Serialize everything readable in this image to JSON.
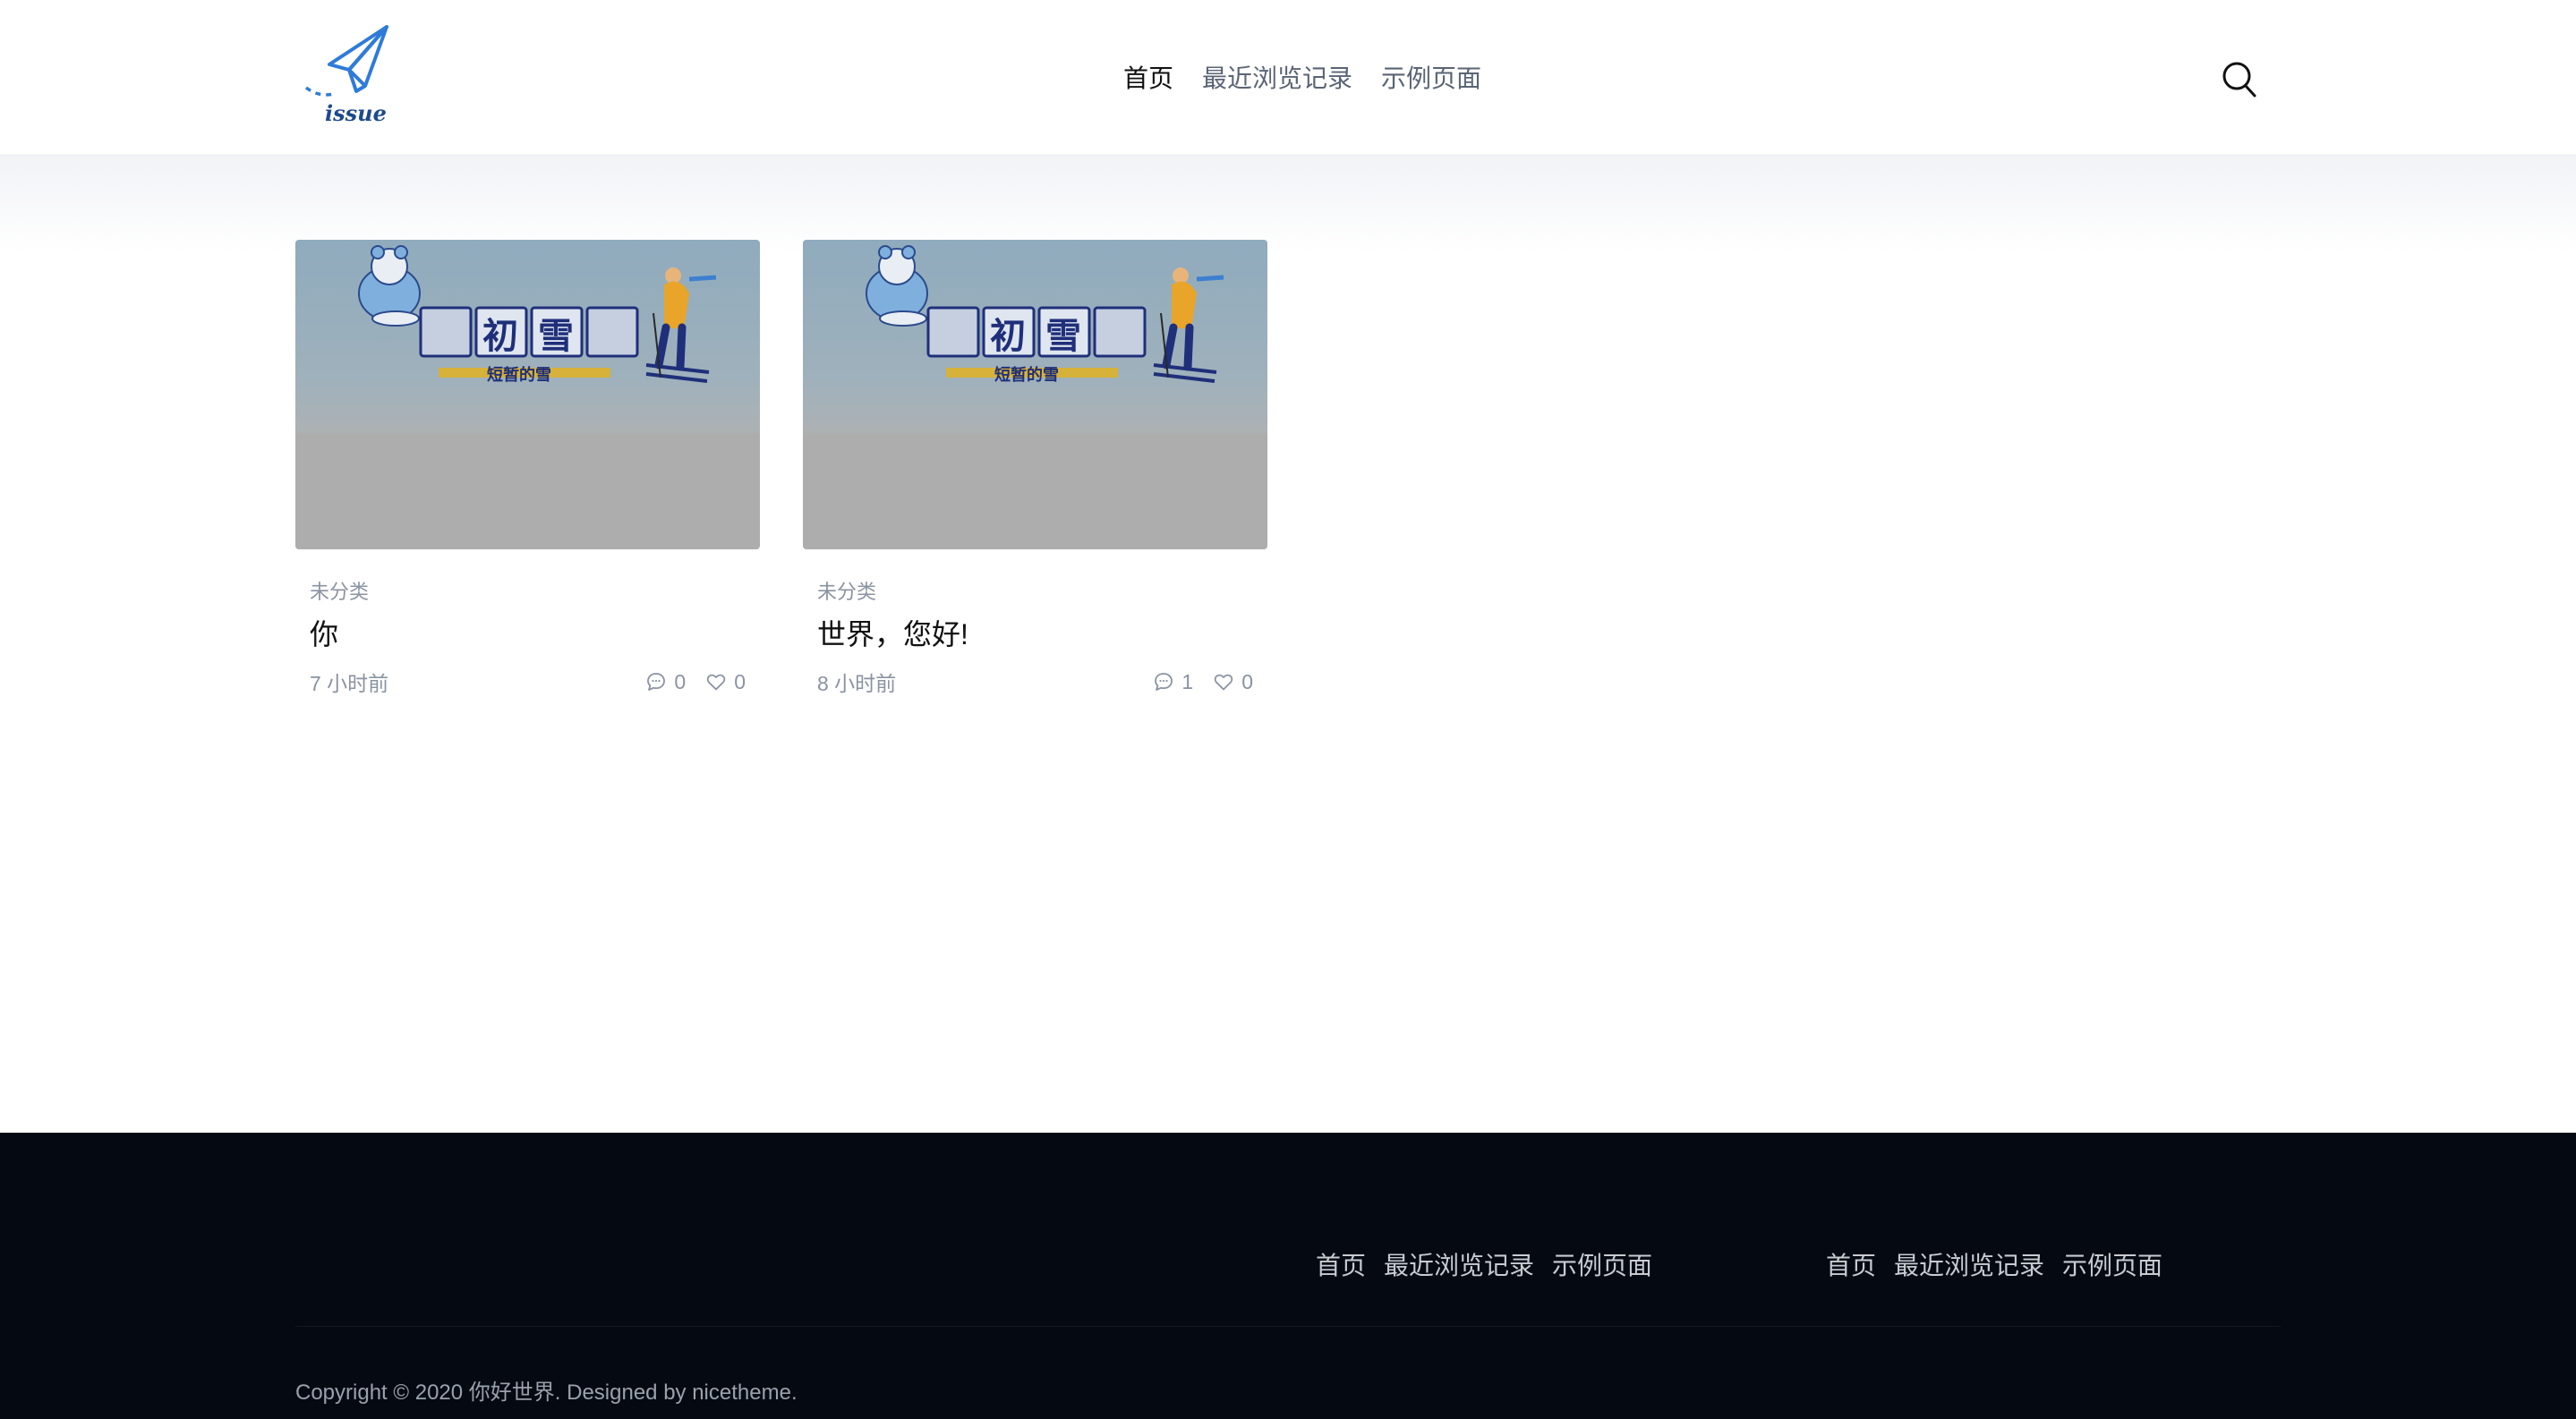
{
  "site": {
    "logo_text": "issue"
  },
  "nav": {
    "items": [
      {
        "label": "首页"
      },
      {
        "label": "最近浏览记录"
      },
      {
        "label": "示例页面"
      }
    ]
  },
  "posts": [
    {
      "banner_word_1": "初",
      "banner_word_2": "雪",
      "banner_sub": "短暂的雪",
      "category": "未分类",
      "title": "你",
      "time": "7 小时前",
      "comments": "0",
      "likes": "0"
    },
    {
      "banner_word_1": "初",
      "banner_word_2": "雪",
      "banner_sub": "短暂的雪",
      "category": "未分类",
      "title": "世界，您好!",
      "time": "8 小时前",
      "comments": "1",
      "likes": "0"
    }
  ],
  "footer": {
    "nav_group_1": [
      "首页",
      "最近浏览记录",
      "示例页面"
    ],
    "nav_group_2": [
      "首页",
      "最近浏览记录",
      "示例页面"
    ],
    "copyright": "Copyright © 2020 你好世界. Designed by nicetheme."
  },
  "colors": {
    "footer_bg": "#050a12",
    "logo_blue": "#2f7bd8",
    "banner_navy": "#1f2f7a"
  }
}
